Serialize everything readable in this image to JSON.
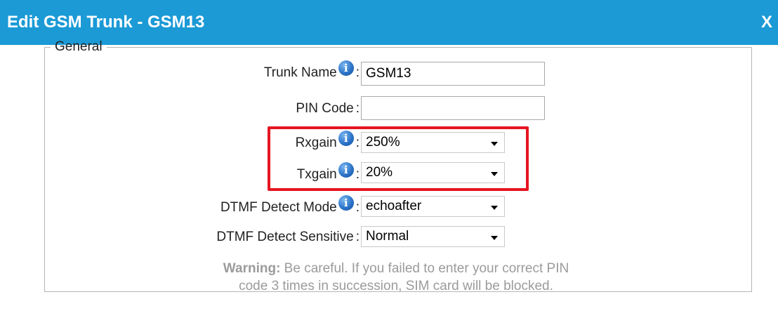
{
  "dialog": {
    "title": "Edit GSM Trunk - GSM13",
    "close_label": "X",
    "header_color": "#1b9ad6"
  },
  "general": {
    "legend": "General",
    "info_glyph": "i",
    "colon": ":",
    "trunk_name": {
      "label": "Trunk Name",
      "value": "GSM13"
    },
    "pin_code": {
      "label": "PIN Code",
      "value": ""
    },
    "rxgain": {
      "label": "Rxgain",
      "value": "250%"
    },
    "txgain": {
      "label": "Txgain",
      "value": "20%"
    },
    "dtmf_detect_mode": {
      "label": "DTMF Detect Mode",
      "value": "echoafter"
    },
    "dtmf_detect_sensitive": {
      "label": "DTMF Detect Sensitive",
      "value": "Normal"
    },
    "warning": {
      "prefix": "Warning:",
      "line1": " Be careful. If you failed to enter your correct PIN",
      "line2": "code 3 times in succession, SIM card will be blocked."
    }
  },
  "highlight_color": "#e51520"
}
